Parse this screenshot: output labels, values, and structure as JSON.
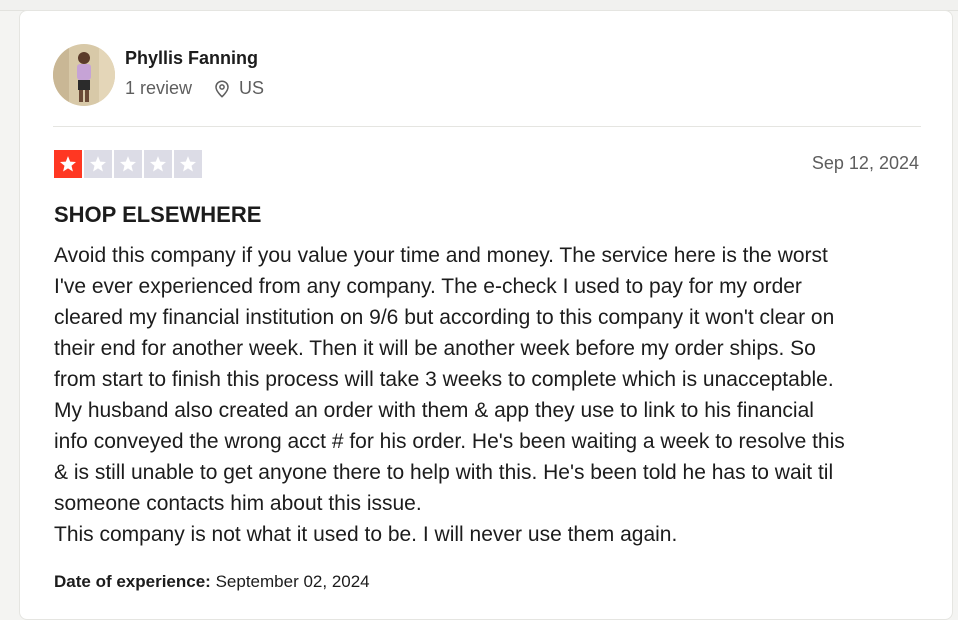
{
  "reviewer": {
    "name": "Phyllis Fanning",
    "review_count": "1 review",
    "country": "US"
  },
  "review": {
    "rating": 1,
    "max_rating": 5,
    "date": "Sep 12, 2024",
    "title": "SHOP ELSEWHERE",
    "body_lines": [
      "Avoid this company if you value your time and money. The service here is the worst",
      "I've ever experienced from any company. The e-check I used to pay for my order",
      "cleared my financial institution on 9/6 but according to this company it won't clear on",
      "their end for another week. Then it will be another week before my order ships. So",
      "from start to finish this process will take 3 weeks to complete which is unacceptable.",
      "My husband also created an order with them & app they use to link to his financial",
      "info conveyed the wrong acct # for his order. He's been waiting a week to resolve this",
      "& is still unable to get anyone there to help with this. He's been told he has to wait til",
      "someone contacts him about this issue.",
      "This company is not what it used to be. I will never use them again."
    ],
    "experience_label": "Date of experience:",
    "experience_date": "September 02, 2024"
  },
  "colors": {
    "star_filled": "#ff3722",
    "star_empty": "#dcdce6",
    "muted_text": "#5e5e5e"
  },
  "icons": {
    "location": "location-pin-icon",
    "star": "star-icon"
  }
}
